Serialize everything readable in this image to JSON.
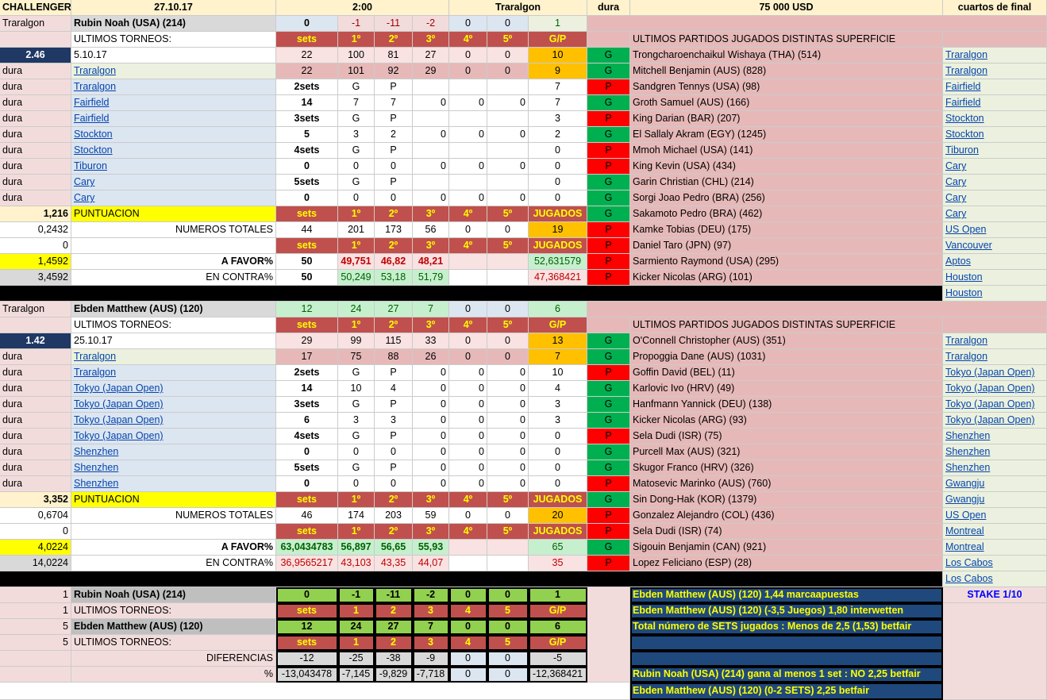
{
  "header": [
    "CHALLENGER",
    "27.10.17",
    "2:00",
    "Traralgon",
    "dura",
    "75 000 USD",
    "cuartos de final"
  ],
  "p1": {
    "name": "Rubin Noah (USA) (214)",
    "loc": "Traralgon",
    "odds": "2.46",
    "date": "5.10.17",
    "ultimos": "ULTIMOS TORNEOS:",
    "total_row": [
      "0",
      "-1",
      "-11",
      "-2",
      "0",
      "0",
      "1"
    ],
    "hdr": [
      "sets",
      "1º",
      "2º",
      "3º",
      "4º",
      "5º",
      "G/P"
    ],
    "r1": [
      "22",
      "100",
      "81",
      "27",
      "0",
      "0",
      "10"
    ],
    "r2": [
      "22",
      "101",
      "92",
      "29",
      "0",
      "0",
      "9"
    ],
    "tourn_l": [
      "Traralgon",
      "Traralgon",
      "Fairfield",
      "Fairfield",
      "Stockton",
      "Stockton",
      "Tiburon",
      "Cary",
      "Cary"
    ],
    "surf": [
      "dura",
      "dura",
      "dura",
      "dura",
      "dura",
      "dura",
      "dura",
      "dura",
      "dura",
      "dura"
    ],
    "sets": [
      [
        "2sets",
        "G",
        "P",
        "",
        "",
        "",
        "7"
      ],
      [
        "14",
        "7",
        "7",
        "0",
        "0",
        "0",
        "7"
      ],
      [
        "3sets",
        "G",
        "P",
        "",
        "",
        "",
        "3"
      ],
      [
        "5",
        "3",
        "2",
        "0",
        "0",
        "0",
        "2"
      ],
      [
        "4sets",
        "G",
        "P",
        "",
        "",
        "",
        "0"
      ],
      [
        "0",
        "0",
        "0",
        "0",
        "0",
        "0",
        "0"
      ],
      [
        "5sets",
        "G",
        "P",
        "",
        "",
        "",
        "0"
      ],
      [
        "0",
        "0",
        "0",
        "0",
        "0",
        "0",
        "0"
      ]
    ],
    "punt": "1,216",
    "punt_label": "PUNTUACION",
    "hdr2": [
      "sets",
      "1º",
      "2º",
      "3º",
      "4º",
      "5º",
      "JUGADOS"
    ],
    "nt_val": "0,2432",
    "nt_label": "NUMEROS TOTALES",
    "nt": [
      "44",
      "201",
      "173",
      "56",
      "0",
      "0",
      "19"
    ],
    "zero": "0",
    "af_val": "1,4592",
    "af_label": "A FAVOR%",
    "af": [
      "50",
      "49,751",
      "46,82",
      "48,21",
      "",
      "",
      "52,631579"
    ],
    "ec_val": "3,4592",
    "ec_label": "EN CONTRA%",
    "ec": [
      "50",
      "50,249",
      "53,18",
      "51,79",
      "",
      "",
      "47,368421"
    ],
    "matches_title": "ULTIMOS PARTIDOS JUGADOS DISTINTAS  SUPERFICIE",
    "matches": [
      [
        "G",
        "Trongcharoenchaikul Wishaya (THA) (514)",
        "Traralgon"
      ],
      [
        "G",
        "Mitchell Benjamin (AUS) (828)",
        "Traralgon"
      ],
      [
        "P",
        "Sandgren Tennys (USA) (98)",
        "Fairfield"
      ],
      [
        "G",
        "Groth Samuel (AUS) (166)",
        "Fairfield"
      ],
      [
        "P",
        "King Darian (BAR) (207)",
        "Stockton"
      ],
      [
        "G",
        "El Sallaly Akram (EGY) (1245)",
        "Stockton"
      ],
      [
        "P",
        "Mmoh Michael (USA) (141)",
        "Tiburon"
      ],
      [
        "P",
        "King Kevin (USA) (434)",
        "Cary"
      ],
      [
        "G",
        "Garin Christian (CHL) (214)",
        "Cary"
      ],
      [
        "G",
        "Sorgi Joao Pedro (BRA) (256)",
        "Cary"
      ],
      [
        "G",
        "Sakamoto Pedro (BRA) (462)",
        "Cary"
      ],
      [
        "P",
        "Kamke Tobias (DEU) (175)",
        "US Open"
      ],
      [
        "P",
        "Daniel Taro (JPN) (97)",
        "Vancouver"
      ],
      [
        "P",
        "Sarmiento Raymond (USA) (295)",
        "Aptos"
      ],
      [
        "P",
        "Kicker Nicolas (ARG) (101)",
        "Houston"
      ]
    ],
    "extra": "Houston"
  },
  "p2": {
    "name": "Ebden Matthew (AUS) (120)",
    "loc": "Traralgon",
    "odds": "1.42",
    "date": "25.10.17",
    "ultimos": "ULTIMOS TORNEOS:",
    "total_row": [
      "12",
      "24",
      "27",
      "7",
      "0",
      "0",
      "6"
    ],
    "hdr": [
      "sets",
      "1º",
      "2º",
      "3º",
      "4º",
      "5º",
      "G/P"
    ],
    "r1": [
      "29",
      "99",
      "115",
      "33",
      "0",
      "0",
      "13"
    ],
    "r2": [
      "17",
      "75",
      "88",
      "26",
      "0",
      "0",
      "7"
    ],
    "tourn_l": [
      "Traralgon",
      "Traralgon",
      "Tokyo (Japan Open)",
      "Tokyo (Japan Open)",
      "Tokyo (Japan Open)",
      "Tokyo (Japan Open)",
      "Shenzhen",
      "Shenzhen",
      "Shenzhen"
    ],
    "surf": [
      "dura",
      "dura",
      "dura",
      "dura",
      "dura",
      "dura",
      "dura",
      "dura",
      "dura",
      "dura"
    ],
    "sets": [
      [
        "2sets",
        "G",
        "P",
        "0",
        "0",
        "0",
        "10"
      ],
      [
        "14",
        "10",
        "4",
        "0",
        "0",
        "0",
        "4"
      ],
      [
        "3sets",
        "G",
        "P",
        "0",
        "0",
        "0",
        "3"
      ],
      [
        "6",
        "3",
        "3",
        "0",
        "0",
        "0",
        "3"
      ],
      [
        "4sets",
        "G",
        "P",
        "0",
        "0",
        "0",
        "0"
      ],
      [
        "0",
        "0",
        "0",
        "0",
        "0",
        "0",
        "0"
      ],
      [
        "5sets",
        "G",
        "P",
        "0",
        "0",
        "0",
        "0"
      ],
      [
        "0",
        "0",
        "0",
        "0",
        "0",
        "0",
        "0"
      ]
    ],
    "punt": "3,352",
    "punt_label": "PUNTUACION",
    "hdr2": [
      "sets",
      "1º",
      "2º",
      "3º",
      "4º",
      "5º",
      "JUGADOS"
    ],
    "nt_val": "0,6704",
    "nt_label": "NUMEROS TOTALES",
    "nt": [
      "46",
      "174",
      "203",
      "59",
      "0",
      "0",
      "20"
    ],
    "zero": "0",
    "af_val": "4,0224",
    "af_label": "A FAVOR%",
    "af": [
      "63,0434783",
      "56,897",
      "56,65",
      "55,93",
      "",
      "",
      "65"
    ],
    "ec_val": "14,0224",
    "ec_label": "EN CONTRA%",
    "ec": [
      "36,9565217",
      "43,103",
      "43,35",
      "44,07",
      "",
      "",
      "35"
    ],
    "matches_title": "ULTIMOS PARTIDOS JUGADOS DISTINTAS  SUPERFICIE",
    "matches": [
      [
        "G",
        "O'Connell Christopher (AUS) (351)",
        "Traralgon"
      ],
      [
        "G",
        "Propoggia Dane (AUS) (1031)",
        "Traralgon"
      ],
      [
        "P",
        "Goffin David (BEL) (11)",
        "Tokyo (Japan Open)"
      ],
      [
        "G",
        "Karlovic Ivo (HRV) (49)",
        "Tokyo (Japan Open)"
      ],
      [
        "G",
        "Hanfmann Yannick (DEU) (138)",
        "Tokyo (Japan Open)"
      ],
      [
        "G",
        "Kicker Nicolas (ARG) (93)",
        "Tokyo (Japan Open)"
      ],
      [
        "P",
        "Sela Dudi (ISR) (75)",
        "Shenzhen"
      ],
      [
        "G",
        "Purcell Max (AUS) (321)",
        "Shenzhen"
      ],
      [
        "G",
        "Skugor Franco (HRV) (326)",
        "Shenzhen"
      ],
      [
        "P",
        "Matosevic Marinko (AUS) (760)",
        "Gwangju"
      ],
      [
        "G",
        "Sin Dong-Hak (KOR) (1379)",
        "Gwangju"
      ],
      [
        "P",
        "Gonzalez Alejandro (COL) (436)",
        "US Open"
      ],
      [
        "P",
        "Sela Dudi (ISR) (74)",
        "Montreal"
      ],
      [
        "G",
        "Sigouin Benjamin (CAN) (921)",
        "Montreal"
      ],
      [
        "P",
        "Lopez Feliciano (ESP) (28)",
        "Los Cabos"
      ]
    ],
    "extra": "Los Cabos"
  },
  "summary": {
    "rows": [
      {
        "n": "1",
        "label": "Rubin Noah (USA) (214)",
        "vals": [
          "0",
          "-1",
          "-11",
          "-2",
          "0",
          "0",
          "1"
        ]
      },
      {
        "n": "1",
        "label": "ULTIMOS TORNEOS:",
        "vals": [
          "sets",
          "1",
          "2",
          "3",
          "4",
          "5",
          "G/P"
        ]
      },
      {
        "n": "5",
        "label": "Ebden Matthew (AUS) (120)",
        "vals": [
          "12",
          "24",
          "27",
          "7",
          "0",
          "0",
          "6"
        ]
      },
      {
        "n": "5",
        "label": "ULTIMOS TORNEOS:",
        "vals": [
          "sets",
          "1",
          "2",
          "3",
          "4",
          "5",
          "G/P"
        ]
      }
    ],
    "dif_label": "DIFERENCIAS",
    "dif": [
      "-12",
      "-25",
      "-38",
      "-9",
      "0",
      "0",
      "-5"
    ],
    "pct_label": "%",
    "pct": [
      "-13,043478",
      "-7,145",
      "-9,829",
      "-7,718",
      "0",
      "0",
      "-12,368421"
    ],
    "picks": [
      "Ebden Matthew (AUS) (120) 1,44 marcaapuestas",
      "Ebden Matthew (AUS) (120) (-3,5 Juegos) 1,80  interwetten",
      "Total número de SETS jugados : Menos de 2,5 (1,53) betfair",
      "",
      "",
      "Rubin Noah (USA) (214) gana al menos 1 set : NO 2,25 betfair",
      "Ebden Matthew (AUS) (120) (0-2 SETS) 2,25 betfair"
    ],
    "stake": "STAKE 1/10"
  }
}
